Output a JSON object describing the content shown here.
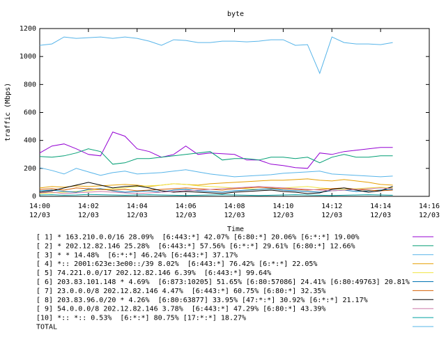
{
  "chart_data": {
    "type": "line",
    "title": "byte",
    "ylabel": "traffic (Mbps)",
    "xlabel": "Time",
    "ylim": [
      0,
      1200
    ],
    "yticks": [
      0,
      200,
      400,
      600,
      800,
      1000,
      1200
    ],
    "xlim": [
      "14:00",
      "14:16"
    ],
    "xticks": [
      {
        "time": "14:00",
        "date": "12/03"
      },
      {
        "time": "14:02",
        "date": "12/03"
      },
      {
        "time": "14:04",
        "date": "12/03"
      },
      {
        "time": "14:06",
        "date": "12/03"
      },
      {
        "time": "14:08",
        "date": "12/03"
      },
      {
        "time": "14:10",
        "date": "12/03"
      },
      {
        "time": "14:12",
        "date": "12/03"
      },
      {
        "time": "14:14",
        "date": "12/03"
      },
      {
        "time": "14:16",
        "date": "12/03"
      }
    ],
    "grid": false,
    "legend_position": "bottom",
    "x": [
      "14:00:00",
      "14:00:30",
      "14:01:00",
      "14:01:30",
      "14:02:00",
      "14:02:30",
      "14:03:00",
      "14:03:30",
      "14:04:00",
      "14:04:30",
      "14:05:00",
      "14:05:30",
      "14:06:00",
      "14:06:30",
      "14:07:00",
      "14:07:30",
      "14:08:00",
      "14:08:30",
      "14:09:00",
      "14:09:30",
      "14:10:00",
      "14:10:30",
      "14:11:00",
      "14:11:30",
      "14:12:00",
      "14:12:30",
      "14:13:00",
      "14:13:30",
      "14:14:00",
      "14:14:30"
    ],
    "series": [
      {
        "name": "[ 1] * 163.210.0.0/16 28.09%  [6:443:*] 42.07% [6:80:*] 20.06% [6:*:*] 19.00%",
        "color": "#9400d3",
        "values": [
          310,
          360,
          375,
          340,
          300,
          290,
          460,
          430,
          340,
          320,
          280,
          300,
          360,
          300,
          310,
          305,
          300,
          260,
          260,
          230,
          220,
          205,
          200,
          310,
          300,
          320,
          330,
          340,
          350,
          350
        ]
      },
      {
        "name": "[ 2] * 202.12.82.146 25.28%  [6:443:*] 57.56% [6:*:*] 29.61% [6:80:*] 12.66%",
        "color": "#009e73",
        "values": [
          285,
          280,
          290,
          310,
          340,
          320,
          230,
          240,
          270,
          270,
          280,
          290,
          300,
          310,
          320,
          260,
          270,
          270,
          260,
          280,
          280,
          270,
          280,
          240,
          280,
          300,
          280,
          280,
          290,
          290
        ]
      },
      {
        "name": "[ 3] * * 14.48%  [6:*:*] 46.24% [6:443:*] 37.17%",
        "color": "#56b4e9",
        "values": [
          1080,
          1090,
          1140,
          1130,
          1135,
          1140,
          1130,
          1140,
          1130,
          1110,
          1080,
          1120,
          1115,
          1100,
          1100,
          1110,
          1110,
          1105,
          1110,
          1120,
          1120,
          1080,
          1085,
          880,
          1140,
          1100,
          1090,
          1090,
          1085,
          1100
        ]
      },
      {
        "name": "[ 4] *:: 2001:623e:3e00::/39 8.02%  [6:443:*] 76.42% [6:*:*] 22.05%",
        "color": "#e69f00",
        "values": [
          60,
          70,
          65,
          75,
          70,
          75,
          80,
          85,
          80,
          70,
          80,
          90,
          85,
          80,
          90,
          95,
          100,
          105,
          110,
          115,
          115,
          120,
          125,
          115,
          110,
          120,
          110,
          100,
          85,
          80
        ]
      },
      {
        "name": "[ 5] 74.221.0.0/17 202.12.82.146 6.39%  [6:443:*] 99.64%",
        "color": "#f0e442",
        "values": [
          20,
          25,
          30,
          35,
          40,
          50,
          55,
          60,
          70,
          75,
          80,
          90,
          85,
          75,
          70,
          65,
          60,
          55,
          50,
          55,
          60,
          65,
          70,
          60,
          55,
          50,
          55,
          60,
          65,
          60
        ]
      },
      {
        "name": "[ 6] 203.83.101.148 * 4.69%  [6:873:10205] 51.65% [6:80:57086] 24.41% [6:80:49763] 20.81%",
        "color": "#0072b2",
        "values": [
          40,
          45,
          35,
          30,
          50,
          55,
          40,
          30,
          35,
          40,
          30,
          45,
          50,
          40,
          35,
          30,
          40,
          45,
          50,
          55,
          45,
          40,
          35,
          30,
          40,
          45,
          35,
          40,
          45,
          50
        ]
      },
      {
        "name": "[ 7] 23.0.0.0/8 202.12.82.146 4.47%  [6:443:*] 60.75% [6:80:*] 32.35%",
        "color": "#d55e00",
        "values": [
          50,
          55,
          45,
          60,
          55,
          50,
          45,
          50,
          40,
          45,
          50,
          55,
          60,
          55,
          50,
          45,
          55,
          60,
          65,
          60,
          55,
          50,
          45,
          50,
          55,
          60,
          50,
          45,
          40,
          45
        ]
      },
      {
        "name": "[ 8] 203.83.96.0/20 * 4.26%  [6:80:63877] 33.95% [47:*:*] 30.92% [6:*:*] 21.17%",
        "color": "#000000",
        "values": [
          30,
          40,
          60,
          80,
          100,
          80,
          60,
          70,
          75,
          60,
          40,
          30,
          35,
          30,
          25,
          20,
          30,
          35,
          40,
          45,
          35,
          30,
          20,
          25,
          50,
          60,
          45,
          30,
          40,
          70
        ]
      },
      {
        "name": "[ 9] 54.0.0.0/8 202.12.82.146 3.78%  [6:443:*] 47.29% [6:80:*] 43.39%",
        "color": "#cc79a7",
        "values": [
          25,
          30,
          20,
          25,
          30,
          35,
          30,
          25,
          20,
          25,
          30,
          35,
          40,
          45,
          50,
          55,
          60,
          65,
          70,
          65,
          60,
          55,
          50,
          45,
          40,
          45,
          50,
          55,
          60,
          55
        ]
      },
      {
        "name": "[10] *:: *:: 0.53%  [6:*:*] 80.75% [17:*:*] 18.27%",
        "color": "#00a0a0",
        "values": [
          10,
          12,
          8,
          10,
          14,
          12,
          10,
          8,
          10,
          12,
          10,
          8,
          6,
          8,
          10,
          12,
          10,
          8,
          6,
          8,
          10,
          12,
          10,
          8,
          6,
          8,
          10,
          12,
          10,
          8
        ]
      },
      {
        "name": "TOTAL",
        "color": "#56b4e9",
        "values": [
          205,
          185,
          160,
          200,
          175,
          150,
          170,
          180,
          160,
          165,
          170,
          180,
          190,
          175,
          160,
          150,
          140,
          145,
          150,
          155,
          165,
          170,
          175,
          180,
          160,
          155,
          150,
          145,
          140,
          145
        ]
      }
    ]
  }
}
